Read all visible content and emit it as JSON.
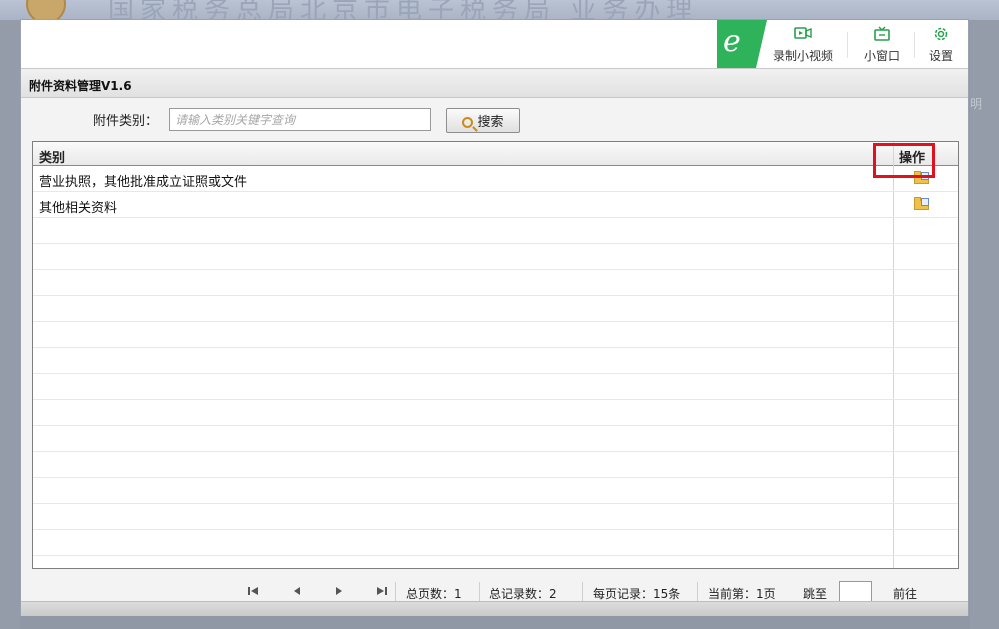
{
  "background": {
    "header_title": "国家税务总局北京市电子税务局  业务办理",
    "right_edge_text": "明"
  },
  "toolbar": {
    "logo_letter": "e",
    "record_label": "录制小视频",
    "mini_window_label": "小窗口",
    "settings_label": "设置"
  },
  "dialog": {
    "title": "附件资料管理V1.6"
  },
  "search": {
    "label": "附件类别：",
    "placeholder": "请输入类别关键字查询",
    "value": "",
    "button_label": "搜索"
  },
  "table": {
    "columns": [
      "类别",
      "操作"
    ],
    "rows": [
      {
        "category": "营业执照，其他批准成立证照或文件",
        "action_icon": "folder-open-icon"
      },
      {
        "category": "其他相关资料",
        "action_icon": "folder-open-icon"
      }
    ],
    "empty_rows": 14
  },
  "pager": {
    "first_icon": "first-page-icon",
    "prev_icon": "prev-page-icon",
    "next_icon": "next-page-icon",
    "last_icon": "last-page-icon",
    "total_pages": "总页数：1",
    "total_records": "总记录数：2",
    "per_page": "每页记录：15条",
    "current_page": "当前第：1页",
    "jump_label": "跳至",
    "jump_value": "",
    "go_label": "前往"
  },
  "colors": {
    "accent_green": "#2fb35a",
    "highlight_red": "#e0121f"
  }
}
